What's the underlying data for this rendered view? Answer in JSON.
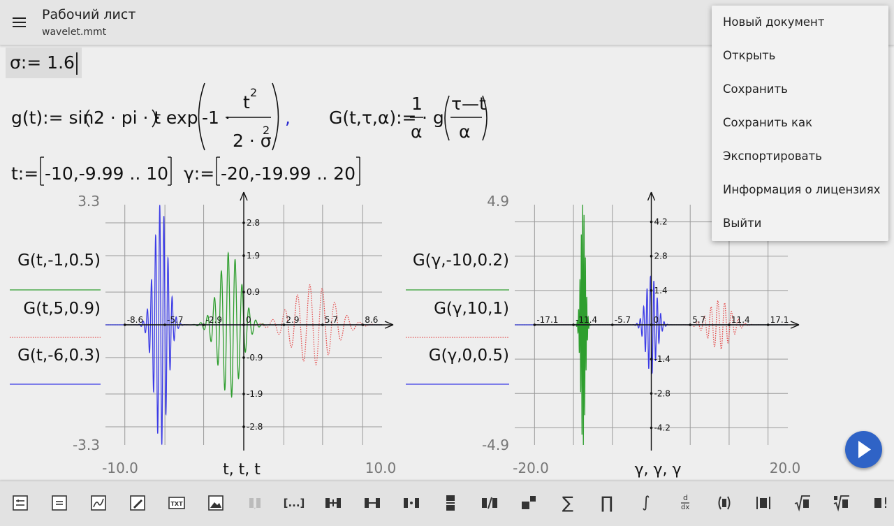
{
  "appbar": {
    "title": "Рабочий лист",
    "subtitle": "wavelet.mmt"
  },
  "overflow_menu": {
    "items": [
      "Новый документ",
      "Открыть",
      "Сохранить",
      "Сохранить как",
      "Экспортировать",
      "Информация о лицензиях",
      "Выйти"
    ]
  },
  "worksheet": {
    "sigma_def": "σ:= 1.6",
    "g_def": {
      "lhs": "g(t):= sin",
      "arg": "2 · pi · t",
      "exp_label": "· exp",
      "exp_arg_prefix": "-1 ·",
      "num_base": "t",
      "num_exp": "2",
      "den_prefix": "2 · σ",
      "den_exp": "2",
      "separator": ","
    },
    "G_def": {
      "lhs": "G(t,τ,α):=",
      "frac_num": "1",
      "frac_den": "α",
      "g_call": "· g",
      "inner_num": "τ—t",
      "inner_den": "α"
    },
    "ranges": {
      "t_lhs": "t:=",
      "t_range": "-10,-9.99 .. 10",
      "gamma_lhs": "γ:=",
      "gamma_range": "-20,-19.99 .. 20"
    }
  },
  "colors": {
    "blue": "#3c3ce6",
    "green": "#2e9e2e",
    "red": "#e34848",
    "accent": "#2f63c6"
  },
  "chart_data": [
    {
      "type": "line",
      "title": "",
      "xlabel": "t, t, t",
      "ylabel": "",
      "xlim": [
        -10.0,
        10.0
      ],
      "ylim": [
        -3.3,
        3.3
      ],
      "x_range_labels": [
        "-10.0",
        "10.0"
      ],
      "y_range_labels": [
        "3.3",
        "-3.3"
      ],
      "x_ticks": [
        "-8.6",
        "-5.7",
        "-2.9",
        "0",
        "2.9",
        "5.7",
        "8.6"
      ],
      "y_ticks": [
        "2.8",
        "1.9",
        "0.9",
        "-0.9",
        "-1.9",
        "-2.8"
      ],
      "grid": true,
      "legend_position": "left",
      "series": [
        {
          "name": "G(t,-1,0.5)",
          "color": "#2e9e2e",
          "style": "solid",
          "tau": -1,
          "alpha": 0.5,
          "peak": 2.0
        },
        {
          "name": "G(t,5,0.9)",
          "color": "#e34848",
          "style": "dotted",
          "tau": 5,
          "alpha": 0.9,
          "peak": 1.1
        },
        {
          "name": "G(t,-6,0.3)",
          "color": "#3c3ce6",
          "style": "solid",
          "tau": -6,
          "alpha": 0.3,
          "peak": 3.3
        }
      ]
    },
    {
      "type": "line",
      "title": "",
      "xlabel": "γ, γ, γ",
      "ylabel": "",
      "xlim": [
        -20.0,
        20.0
      ],
      "ylim": [
        -4.9,
        4.9
      ],
      "x_range_labels": [
        "-20.0",
        "20.0"
      ],
      "y_range_labels": [
        "4.9",
        "-4.9"
      ],
      "x_ticks": [
        "-17.1",
        "-11.4",
        "-5.7",
        "0",
        "5.7",
        "11.4",
        "17.1"
      ],
      "y_ticks": [
        "4.2",
        "2.8",
        "1.4",
        "-1.4",
        "-2.8",
        "-4.2"
      ],
      "grid": true,
      "legend_position": "left",
      "series": [
        {
          "name": "G(γ,-10,0.2)",
          "color": "#2e9e2e",
          "style": "solid",
          "tau": -10,
          "alpha": 0.2,
          "peak": 4.9
        },
        {
          "name": "G(γ,10,1)",
          "color": "#e34848",
          "style": "dotted",
          "tau": 10,
          "alpha": 1,
          "peak": 1.0
        },
        {
          "name": "G(γ,0,0.5)",
          "color": "#3c3ce6",
          "style": "solid",
          "tau": 0,
          "alpha": 0.5,
          "peak": 2.0
        }
      ]
    }
  ],
  "toolbar": {
    "icons": [
      "insert-equation-icon",
      "insert-definition-icon",
      "insert-plot-icon",
      "insert-drawing-icon",
      "insert-text-icon",
      "insert-image-icon",
      "interval-icon",
      "ellipsis-bracket-icon",
      "add-column-icon",
      "column-span-icon",
      "column-split-icon",
      "row-split-icon",
      "divide-icon",
      "power-icon",
      "sum-icon",
      "product-icon",
      "integral-icon",
      "derivative-icon",
      "parentheses-icon",
      "abs-value-icon",
      "sqrt-icon",
      "nth-root-icon",
      "factorial-icon"
    ],
    "glyphs": {
      "ellipsis": "[...]",
      "sum": "∑",
      "product": "∏",
      "integral": "∫",
      "deriv_top": "d",
      "deriv_bottom": "dx",
      "factorial": "!"
    }
  },
  "fab": {
    "icon": "play-icon"
  }
}
